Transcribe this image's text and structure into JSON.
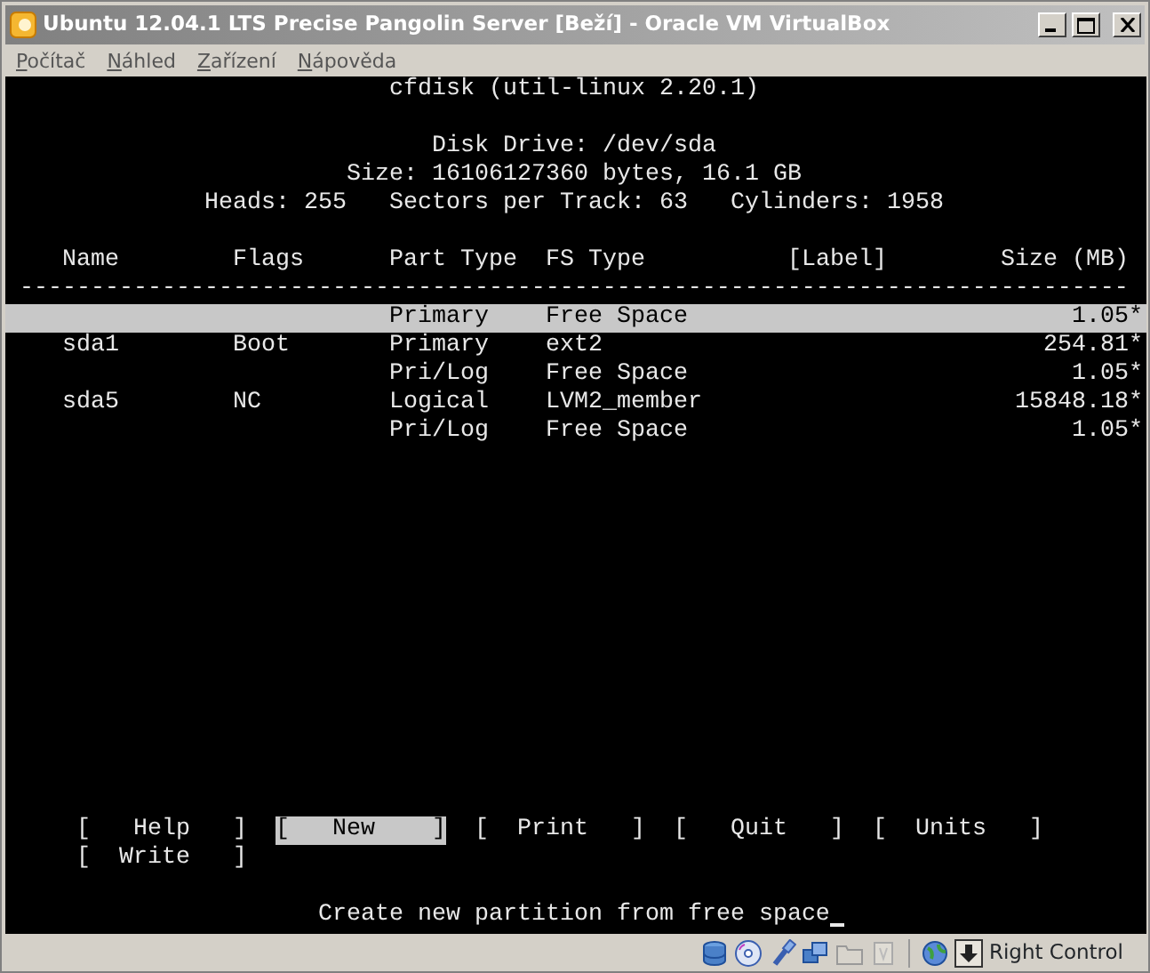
{
  "window": {
    "title": "Ubuntu 12.04.1 LTS Precise Pangolin Server [Beží] - Oracle VM VirtualBox"
  },
  "menu": [
    "Počítač",
    "Náhled",
    "Zařízení",
    "Nápověda"
  ],
  "terminal": {
    "title": "cfdisk (util-linux 2.20.1)",
    "disk_info": [
      "Disk Drive: /dev/sda",
      "Size: 16106127360 bytes, 16.1 GB",
      "Heads: 255   Sectors per Track: 63   Cylinders: 1958"
    ],
    "columns": [
      "Name",
      "Flags",
      "Part Type",
      "FS Type",
      "[Label]",
      "Size (MB)"
    ],
    "separator": "------------------------------------------------------------------------------",
    "rows": [
      {
        "name": "",
        "flags": "",
        "part_type": "Primary",
        "fs_type": "Free Space",
        "size": "1.05*",
        "selected": true
      },
      {
        "name": "sda1",
        "flags": "Boot",
        "part_type": "Primary",
        "fs_type": "ext2",
        "size": "254.81*",
        "selected": false
      },
      {
        "name": "",
        "flags": "",
        "part_type": "Pri/Log",
        "fs_type": "Free Space",
        "size": "1.05*",
        "selected": false
      },
      {
        "name": "sda5",
        "flags": "NC",
        "part_type": "Logical",
        "fs_type": "LVM2_member",
        "size": "15848.18*",
        "selected": false
      },
      {
        "name": "",
        "flags": "",
        "part_type": "Pri/Log",
        "fs_type": "Free Space",
        "size": "1.05*",
        "selected": false
      }
    ],
    "buttons": [
      {
        "label": "[   Help   ]",
        "selected": false
      },
      {
        "label": "[   New    ]",
        "selected": true
      },
      {
        "label": "[  Print   ]",
        "selected": false
      },
      {
        "label": "[   Quit   ]",
        "selected": false
      },
      {
        "label": "[  Units   ]",
        "selected": false
      },
      {
        "label": "[  Write   ]",
        "selected": false
      }
    ],
    "status": "Create new partition from free space"
  },
  "status_bar": {
    "host_key": "Right Control"
  }
}
